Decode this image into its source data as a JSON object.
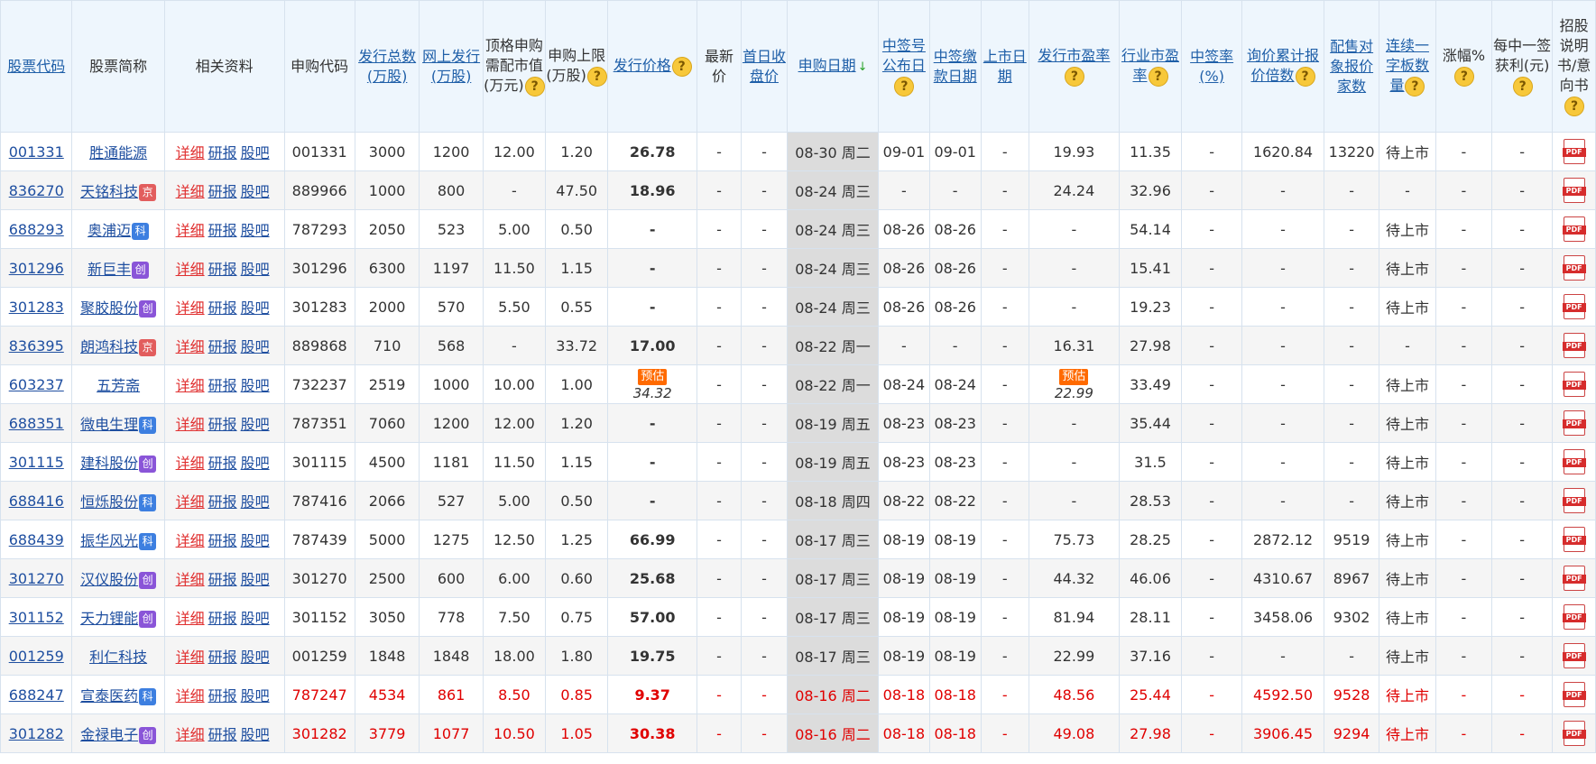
{
  "headers": [
    {
      "key": "code",
      "label": "股票代码",
      "link": true
    },
    {
      "key": "name",
      "label": "股票简称",
      "link": false
    },
    {
      "key": "info",
      "label": "相关资料",
      "link": false
    },
    {
      "key": "sub_code",
      "label": "申购代码",
      "link": false
    },
    {
      "key": "total",
      "label": "发行总数(万股)",
      "link": true
    },
    {
      "key": "online",
      "label": "网上发行(万股)",
      "link": true
    },
    {
      "key": "need",
      "label": "顶格申购需配市值(万元)",
      "link": false,
      "help": true
    },
    {
      "key": "limit",
      "label": "申购上限(万股)",
      "link": false,
      "help": true
    },
    {
      "key": "price",
      "label": "发行价格",
      "link": true,
      "help": true
    },
    {
      "key": "latest",
      "label": "最新价",
      "link": false
    },
    {
      "key": "first_close",
      "label": "首日收盘价",
      "link": true
    },
    {
      "key": "date",
      "label": "申购日期",
      "link": true,
      "sort": "↓"
    },
    {
      "key": "announce",
      "label": "中签号公布日",
      "link": true,
      "help": true
    },
    {
      "key": "pay",
      "label": "中签缴款日期",
      "link": true
    },
    {
      "key": "listing",
      "label": "上市日期",
      "link": true
    },
    {
      "key": "pe",
      "label": "发行市盈率",
      "link": true,
      "help": true
    },
    {
      "key": "ind_pe",
      "label": "行业市盈率",
      "link": true,
      "help": true
    },
    {
      "key": "win_rate",
      "label": "中签率(%)",
      "link": true
    },
    {
      "key": "inquiry",
      "label": "询价累计报价倍数",
      "link": true,
      "help": true
    },
    {
      "key": "placement",
      "label": "配售对象报价家数",
      "link": true
    },
    {
      "key": "boards",
      "label": "连续一字板数量",
      "link": true,
      "help": true
    },
    {
      "key": "rise",
      "label": "涨幅%",
      "link": false,
      "help": true
    },
    {
      "key": "profit",
      "label": "每中一签获利(元)",
      "link": false,
      "help": true
    },
    {
      "key": "prospectus",
      "label": "招股说明书/意向书",
      "link": false,
      "help": true
    }
  ],
  "info_links": [
    "详细",
    "研报",
    "股吧"
  ],
  "estimate_label": "预估",
  "rows": [
    {
      "code": "001331",
      "name": "胜通能源",
      "board": "",
      "sub_code": "001331",
      "total": "3000",
      "online": "1200",
      "need": "12.00",
      "limit": "1.20",
      "price": "26.78",
      "price_est": false,
      "latest": "-",
      "first_close": "-",
      "date": "08-30 周二",
      "announce": "09-01",
      "pay": "09-01",
      "listing": "-",
      "pe": "19.93",
      "pe_est": false,
      "ind_pe": "11.35",
      "win_rate": "-",
      "inquiry": "1620.84",
      "placement": "13220",
      "boards": "待上市",
      "rise": "-",
      "profit": "-",
      "hl": false
    },
    {
      "code": "836270",
      "name": "天铭科技",
      "board": "京",
      "sub_code": "889966",
      "total": "1000",
      "online": "800",
      "need": "-",
      "limit": "47.50",
      "price": "18.96",
      "price_est": false,
      "latest": "-",
      "first_close": "-",
      "date": "08-24 周三",
      "announce": "-",
      "pay": "-",
      "listing": "-",
      "pe": "24.24",
      "pe_est": false,
      "ind_pe": "32.96",
      "win_rate": "-",
      "inquiry": "-",
      "placement": "-",
      "boards": "-",
      "rise": "-",
      "profit": "-",
      "hl": false
    },
    {
      "code": "688293",
      "name": "奥浦迈",
      "board": "科",
      "sub_code": "787293",
      "total": "2050",
      "online": "523",
      "need": "5.00",
      "limit": "0.50",
      "price": "-",
      "price_est": false,
      "latest": "-",
      "first_close": "-",
      "date": "08-24 周三",
      "announce": "08-26",
      "pay": "08-26",
      "listing": "-",
      "pe": "-",
      "pe_est": false,
      "ind_pe": "54.14",
      "win_rate": "-",
      "inquiry": "-",
      "placement": "-",
      "boards": "待上市",
      "rise": "-",
      "profit": "-",
      "hl": false
    },
    {
      "code": "301296",
      "name": "新巨丰",
      "board": "创",
      "sub_code": "301296",
      "total": "6300",
      "online": "1197",
      "need": "11.50",
      "limit": "1.15",
      "price": "-",
      "price_est": false,
      "latest": "-",
      "first_close": "-",
      "date": "08-24 周三",
      "announce": "08-26",
      "pay": "08-26",
      "listing": "-",
      "pe": "-",
      "pe_est": false,
      "ind_pe": "15.41",
      "win_rate": "-",
      "inquiry": "-",
      "placement": "-",
      "boards": "待上市",
      "rise": "-",
      "profit": "-",
      "hl": false
    },
    {
      "code": "301283",
      "name": "聚胶股份",
      "board": "创",
      "sub_code": "301283",
      "total": "2000",
      "online": "570",
      "need": "5.50",
      "limit": "0.55",
      "price": "-",
      "price_est": false,
      "latest": "-",
      "first_close": "-",
      "date": "08-24 周三",
      "announce": "08-26",
      "pay": "08-26",
      "listing": "-",
      "pe": "-",
      "pe_est": false,
      "ind_pe": "19.23",
      "win_rate": "-",
      "inquiry": "-",
      "placement": "-",
      "boards": "待上市",
      "rise": "-",
      "profit": "-",
      "hl": false
    },
    {
      "code": "836395",
      "name": "朗鸿科技",
      "board": "京",
      "sub_code": "889868",
      "total": "710",
      "online": "568",
      "need": "-",
      "limit": "33.72",
      "price": "17.00",
      "price_est": false,
      "latest": "-",
      "first_close": "-",
      "date": "08-22 周一",
      "announce": "-",
      "pay": "-",
      "listing": "-",
      "pe": "16.31",
      "pe_est": false,
      "ind_pe": "27.98",
      "win_rate": "-",
      "inquiry": "-",
      "placement": "-",
      "boards": "-",
      "rise": "-",
      "profit": "-",
      "hl": false
    },
    {
      "code": "603237",
      "name": "五芳斋",
      "board": "",
      "sub_code": "732237",
      "total": "2519",
      "online": "1000",
      "need": "10.00",
      "limit": "1.00",
      "price": "34.32",
      "price_est": true,
      "latest": "-",
      "first_close": "-",
      "date": "08-22 周一",
      "announce": "08-24",
      "pay": "08-24",
      "listing": "-",
      "pe": "22.99",
      "pe_est": true,
      "ind_pe": "33.49",
      "win_rate": "-",
      "inquiry": "-",
      "placement": "-",
      "boards": "待上市",
      "rise": "-",
      "profit": "-",
      "hl": false
    },
    {
      "code": "688351",
      "name": "微电生理",
      "board": "科",
      "sub_code": "787351",
      "total": "7060",
      "online": "1200",
      "need": "12.00",
      "limit": "1.20",
      "price": "-",
      "price_est": false,
      "latest": "-",
      "first_close": "-",
      "date": "08-19 周五",
      "announce": "08-23",
      "pay": "08-23",
      "listing": "-",
      "pe": "-",
      "pe_est": false,
      "ind_pe": "35.44",
      "win_rate": "-",
      "inquiry": "-",
      "placement": "-",
      "boards": "待上市",
      "rise": "-",
      "profit": "-",
      "hl": false
    },
    {
      "code": "301115",
      "name": "建科股份",
      "board": "创",
      "sub_code": "301115",
      "total": "4500",
      "online": "1181",
      "need": "11.50",
      "limit": "1.15",
      "price": "-",
      "price_est": false,
      "latest": "-",
      "first_close": "-",
      "date": "08-19 周五",
      "announce": "08-23",
      "pay": "08-23",
      "listing": "-",
      "pe": "-",
      "pe_est": false,
      "ind_pe": "31.5",
      "win_rate": "-",
      "inquiry": "-",
      "placement": "-",
      "boards": "待上市",
      "rise": "-",
      "profit": "-",
      "hl": false
    },
    {
      "code": "688416",
      "name": "恒烁股份",
      "board": "科",
      "sub_code": "787416",
      "total": "2066",
      "online": "527",
      "need": "5.00",
      "limit": "0.50",
      "price": "-",
      "price_est": false,
      "latest": "-",
      "first_close": "-",
      "date": "08-18 周四",
      "announce": "08-22",
      "pay": "08-22",
      "listing": "-",
      "pe": "-",
      "pe_est": false,
      "ind_pe": "28.53",
      "win_rate": "-",
      "inquiry": "-",
      "placement": "-",
      "boards": "待上市",
      "rise": "-",
      "profit": "-",
      "hl": false
    },
    {
      "code": "688439",
      "name": "振华风光",
      "board": "科",
      "sub_code": "787439",
      "total": "5000",
      "online": "1275",
      "need": "12.50",
      "limit": "1.25",
      "price": "66.99",
      "price_est": false,
      "latest": "-",
      "first_close": "-",
      "date": "08-17 周三",
      "announce": "08-19",
      "pay": "08-19",
      "listing": "-",
      "pe": "75.73",
      "pe_est": false,
      "ind_pe": "28.25",
      "win_rate": "-",
      "inquiry": "2872.12",
      "placement": "9519",
      "boards": "待上市",
      "rise": "-",
      "profit": "-",
      "hl": false
    },
    {
      "code": "301270",
      "name": "汉仪股份",
      "board": "创",
      "sub_code": "301270",
      "total": "2500",
      "online": "600",
      "need": "6.00",
      "limit": "0.60",
      "price": "25.68",
      "price_est": false,
      "latest": "-",
      "first_close": "-",
      "date": "08-17 周三",
      "announce": "08-19",
      "pay": "08-19",
      "listing": "-",
      "pe": "44.32",
      "pe_est": false,
      "ind_pe": "46.06",
      "win_rate": "-",
      "inquiry": "4310.67",
      "placement": "8967",
      "boards": "待上市",
      "rise": "-",
      "profit": "-",
      "hl": false
    },
    {
      "code": "301152",
      "name": "天力锂能",
      "board": "创",
      "sub_code": "301152",
      "total": "3050",
      "online": "778",
      "need": "7.50",
      "limit": "0.75",
      "price": "57.00",
      "price_est": false,
      "latest": "-",
      "first_close": "-",
      "date": "08-17 周三",
      "announce": "08-19",
      "pay": "08-19",
      "listing": "-",
      "pe": "81.94",
      "pe_est": false,
      "ind_pe": "28.11",
      "win_rate": "-",
      "inquiry": "3458.06",
      "placement": "9302",
      "boards": "待上市",
      "rise": "-",
      "profit": "-",
      "hl": false
    },
    {
      "code": "001259",
      "name": "利仁科技",
      "board": "",
      "sub_code": "001259",
      "total": "1848",
      "online": "1848",
      "need": "18.00",
      "limit": "1.80",
      "price": "19.75",
      "price_est": false,
      "latest": "-",
      "first_close": "-",
      "date": "08-17 周三",
      "announce": "08-19",
      "pay": "08-19",
      "listing": "-",
      "pe": "22.99",
      "pe_est": false,
      "ind_pe": "37.16",
      "win_rate": "-",
      "inquiry": "-",
      "placement": "-",
      "boards": "待上市",
      "rise": "-",
      "profit": "-",
      "hl": false
    },
    {
      "code": "688247",
      "name": "宣泰医药",
      "board": "科",
      "sub_code": "787247",
      "total": "4534",
      "online": "861",
      "need": "8.50",
      "limit": "0.85",
      "price": "9.37",
      "price_est": false,
      "latest": "-",
      "first_close": "-",
      "date": "08-16 周二",
      "announce": "08-18",
      "pay": "08-18",
      "listing": "-",
      "pe": "48.56",
      "pe_est": false,
      "ind_pe": "25.44",
      "win_rate": "-",
      "inquiry": "4592.50",
      "placement": "9528",
      "boards": "待上市",
      "rise": "-",
      "profit": "-",
      "hl": true
    },
    {
      "code": "301282",
      "name": "金禄电子",
      "board": "创",
      "sub_code": "301282",
      "total": "3779",
      "online": "1077",
      "need": "10.50",
      "limit": "1.05",
      "price": "30.38",
      "price_est": false,
      "latest": "-",
      "first_close": "-",
      "date": "08-16 周二",
      "announce": "08-18",
      "pay": "08-18",
      "listing": "-",
      "pe": "49.08",
      "pe_est": false,
      "ind_pe": "27.98",
      "win_rate": "-",
      "inquiry": "3906.45",
      "placement": "9294",
      "boards": "待上市",
      "rise": "-",
      "profit": "-",
      "hl": true
    }
  ]
}
